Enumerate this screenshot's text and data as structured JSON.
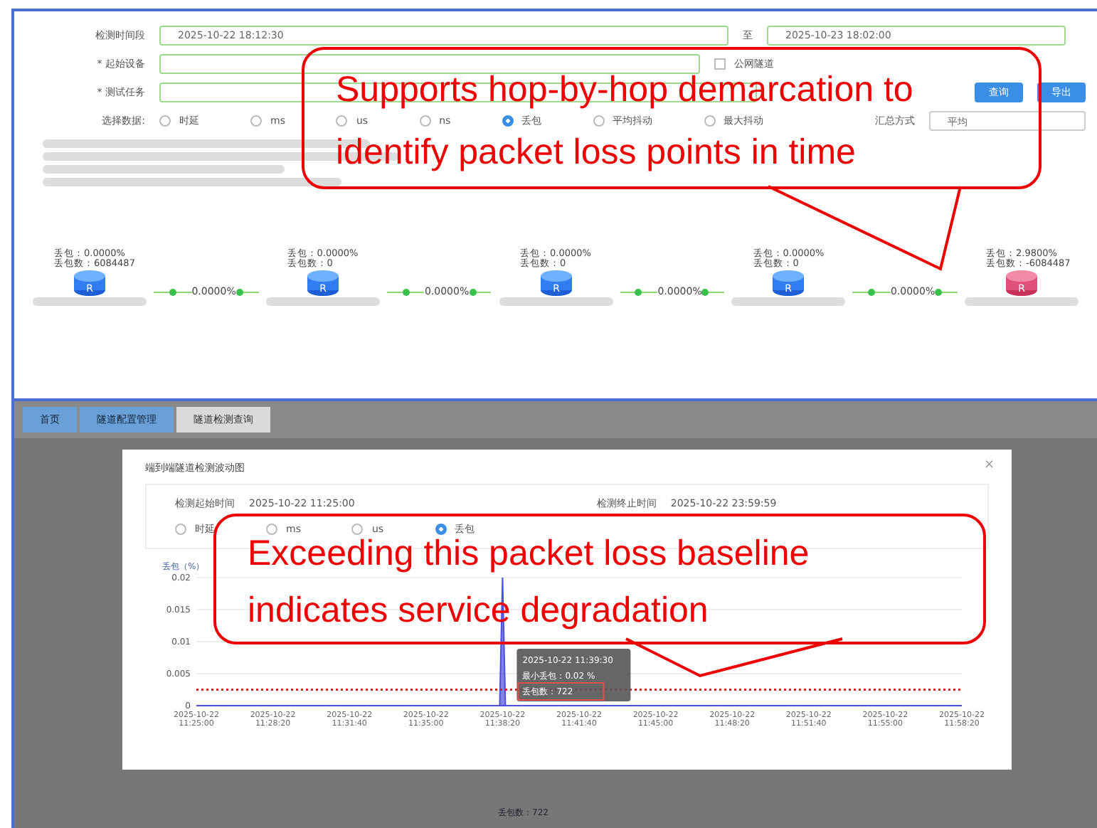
{
  "query_form": {
    "time_label": "检测时间段",
    "start_time": "2025-10-22 18:12:30",
    "to_label": "至",
    "end_time": "2025-10-23 18:02:00",
    "device_label": "* 起始设备",
    "public_tunnel": {
      "label": "公网隧道",
      "checked": false
    },
    "task_label": "* 测试任务",
    "buttons": [
      "查询",
      "导出"
    ]
  },
  "data_options": {
    "label": "选择数据:",
    "options": [
      {
        "label": "时延",
        "selected": false
      },
      {
        "label": "ms",
        "selected": false
      },
      {
        "label": "us",
        "selected": false
      },
      {
        "label": "ns",
        "selected": false
      },
      {
        "label": "丢包",
        "selected": true
      },
      {
        "label": "平均抖动",
        "selected": false
      },
      {
        "label": "最大抖动",
        "selected": false
      }
    ],
    "summary_label": "汇总方式",
    "summary_value": "平均"
  },
  "topology": {
    "hops": [
      {
        "loss": "丢包：0.0000%",
        "count": "丢包数：6084487",
        "badge": "R",
        "alarm": false
      },
      {
        "loss": "丢包：0.0000%",
        "count": "丢包数：0",
        "badge": "R",
        "alarm": false
      },
      {
        "loss": "丢包：0.0000%",
        "count": "丢包数：0",
        "badge": "R",
        "alarm": false
      },
      {
        "loss": "丢包：0.0000%",
        "count": "丢包数：0",
        "badge": "R",
        "alarm": false
      },
      {
        "loss": "丢包：2.9800%",
        "count": "丢包数：-6084487",
        "badge": "R",
        "alarm": true
      }
    ],
    "links": [
      "0.0000%",
      "0.0000%",
      "0.0000%",
      "0.0000%"
    ]
  },
  "tabs": [
    {
      "label": "首页",
      "selected": false
    },
    {
      "label": "隧道配置管理",
      "selected": false
    },
    {
      "label": "隧道检测查询",
      "selected": true
    }
  ],
  "modal": {
    "title": "端到端隧道检测波动图",
    "close": "×",
    "start_label": "检测起始时间",
    "start_time": "2025-10-22 11:25:00",
    "end_label": "检测终止时间",
    "end_time": "2025-10-22 23:59:59",
    "options": [
      {
        "label": "时延",
        "selected": false
      },
      {
        "label": "ms",
        "selected": false
      },
      {
        "label": "us",
        "selected": false
      },
      {
        "label": "丢包",
        "selected": true
      }
    ],
    "chart_data": {
      "type": "area",
      "ylabel": "丢包（%）",
      "categories": [
        "2025-10-22 11:25:00",
        "2025-10-22 11:28:20",
        "2025-10-22 11:31:40",
        "2025-10-22 11:35:00",
        "2025-10-22 11:38:20",
        "2025-10-22 11:41:40",
        "2025-10-22 11:45:00",
        "2025-10-22 11:48:20",
        "2025-10-22 11:51:40",
        "2025-10-22 11:55:00",
        "2025-10-22 11:58:20"
      ],
      "series": [
        {
          "color": "#4b4fe0",
          "values": [
            0,
            0,
            0,
            0,
            0.02,
            0,
            0,
            0,
            0,
            0,
            0
          ]
        }
      ],
      "ylim": [
        0,
        0.02
      ],
      "yticks": [
        0,
        0.005,
        0.01,
        0.015,
        0.02
      ],
      "grid": true,
      "ref_lines": [
        {
          "axis": "y",
          "value": 0.0025,
          "color": "#e02020"
        }
      ]
    },
    "tooltip": {
      "title": "2025-10-22 11:39:30",
      "rows": [
        "最小丢包：0.02 %",
        "丢包数：722"
      ]
    }
  },
  "status_text": "丢包数：722",
  "callouts": [
    "Supports hop-by-hop demarcation to identify packet loss points in time",
    "Exceeding this packet loss baseline indicates service degradation"
  ]
}
